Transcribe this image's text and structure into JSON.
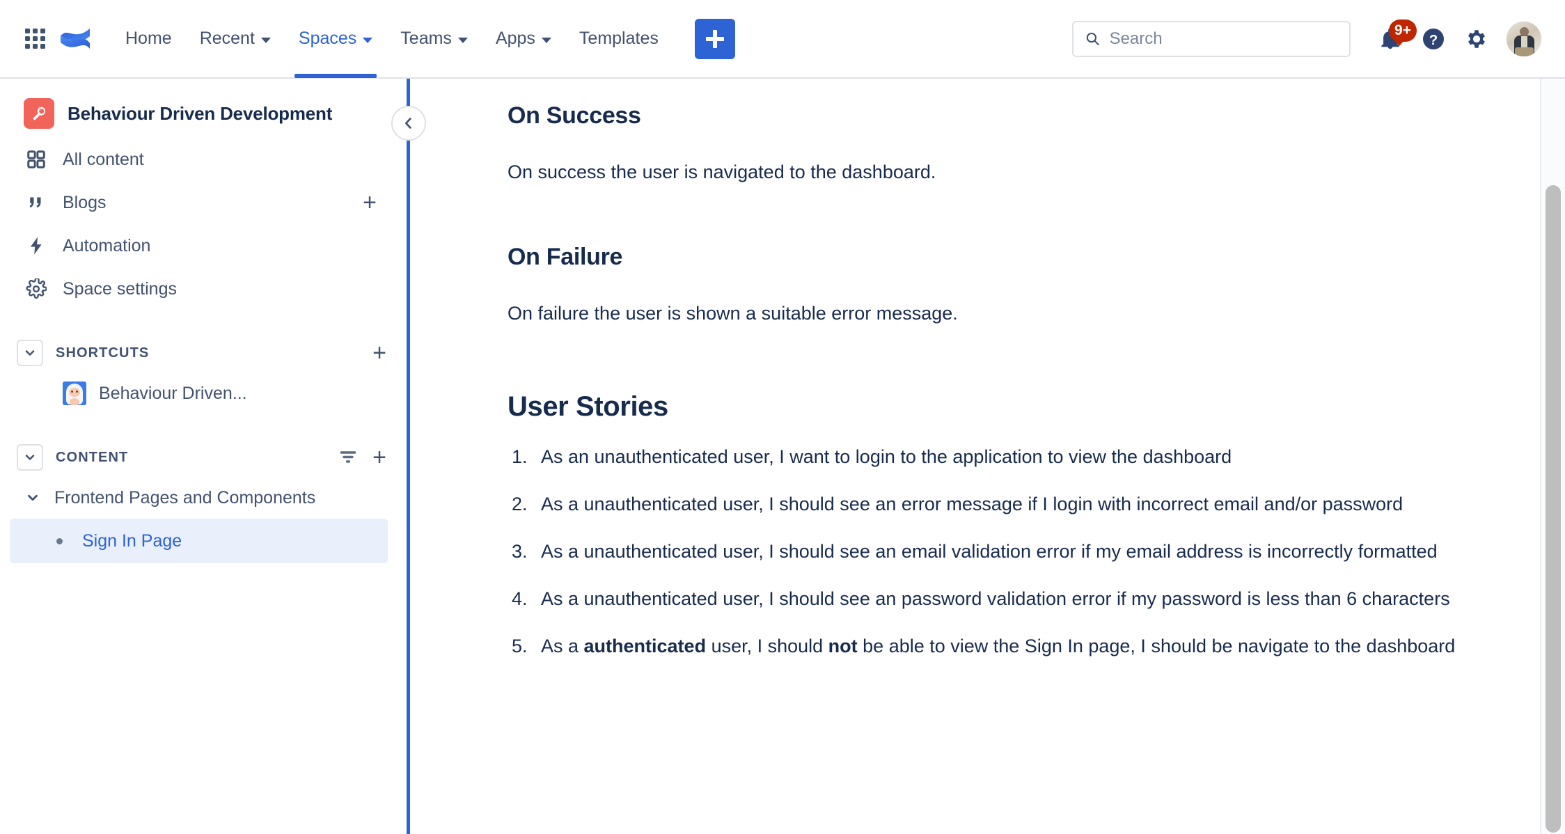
{
  "header": {
    "app_switcher_icon": "grid-apps-icon",
    "logo_icon": "confluence-logo-icon",
    "nav_items": [
      {
        "label": "Home",
        "has_chevron": false,
        "active": false
      },
      {
        "label": "Recent",
        "has_chevron": true,
        "active": false
      },
      {
        "label": "Spaces",
        "has_chevron": true,
        "active": true
      },
      {
        "label": "Teams",
        "has_chevron": true,
        "active": false
      },
      {
        "label": "Apps",
        "has_chevron": true,
        "active": false
      },
      {
        "label": "Templates",
        "has_chevron": false,
        "active": false
      }
    ],
    "create_button_label": "+",
    "search": {
      "placeholder": "Search",
      "value": "",
      "icon": "search-icon"
    },
    "notifications": {
      "icon": "notification-bell-icon",
      "badge": "9+",
      "badge_color": "#BF2600"
    },
    "help_icon": "help-question-icon",
    "settings_icon": "gear-icon",
    "avatar_icon": "user-avatar"
  },
  "sidebar": {
    "space": {
      "name": "Behaviour Driven Development",
      "icon": "wrench-space-icon",
      "icon_color": "#F2645A"
    },
    "nav_items": [
      {
        "label": "All content",
        "icon": "grid-squares-icon",
        "has_add": false
      },
      {
        "label": "Blogs",
        "icon": "quote-marks-icon",
        "has_add": true,
        "add_label": "+"
      },
      {
        "label": "Automation",
        "icon": "lightning-bolt-icon",
        "has_add": false
      },
      {
        "label": "Space settings",
        "icon": "gear-icon",
        "has_add": false
      }
    ],
    "shortcuts_section": {
      "title": "SHORTCUTS",
      "toggle_icon": "chevron-down-icon",
      "add_label": "+",
      "items": [
        {
          "label": "Behaviour Driven...",
          "icon": "yeti-emoji-icon"
        }
      ]
    },
    "content_section": {
      "title": "CONTENT",
      "toggle_icon": "chevron-down-icon",
      "filter_icon": "filter-funnel-icon",
      "add_label": "+",
      "tree": [
        {
          "label": "Frontend Pages and Components",
          "icon": "chevron-down-icon",
          "level": 0,
          "selected": false
        },
        {
          "label": "Sign In Page",
          "icon": "bullet-dot-icon",
          "level": 1,
          "selected": true
        }
      ]
    },
    "collapse_button_icon": "chevron-left-icon",
    "divider_color": "#2E63D6"
  },
  "main": {
    "sections": [
      {
        "heading": "On Success",
        "body": "On success the user is navigated to the dashboard."
      },
      {
        "heading": "On Failure",
        "body": "On failure the user is shown a suitable error message."
      }
    ],
    "user_stories_title": "User Stories",
    "user_stories": [
      {
        "parts": [
          {
            "text": "As an unauthenticated user, I want to login to the application to view the dashboard",
            "bold": false
          }
        ]
      },
      {
        "parts": [
          {
            "text": "As a unauthenticated user, I should see an error message if I login with incorrect email and/or password",
            "bold": false
          }
        ]
      },
      {
        "parts": [
          {
            "text": "As a unauthenticated user, I should see an email validation error if my email address is incorrectly formatted",
            "bold": false
          }
        ]
      },
      {
        "parts": [
          {
            "text": "As a unauthenticated user, I should see an password validation error if my password is less than 6 characters",
            "bold": false
          }
        ]
      },
      {
        "parts": [
          {
            "text": "As a ",
            "bold": false
          },
          {
            "text": "authenticated",
            "bold": true
          },
          {
            "text": " user, I should ",
            "bold": false
          },
          {
            "text": "not",
            "bold": true
          },
          {
            "text": " be able to view the Sign In page, I should be navigate to the dashboard",
            "bold": false
          }
        ]
      }
    ]
  },
  "scrollbar": {
    "name": "vertical-scrollbar",
    "thumb_color": "#BEBEBE"
  },
  "colors": {
    "accent_blue": "#2E63D6",
    "text_primary": "#172B4D",
    "text_secondary": "#42526E",
    "selected_bg": "#E9F0FC",
    "border": "#DFE1E6"
  }
}
